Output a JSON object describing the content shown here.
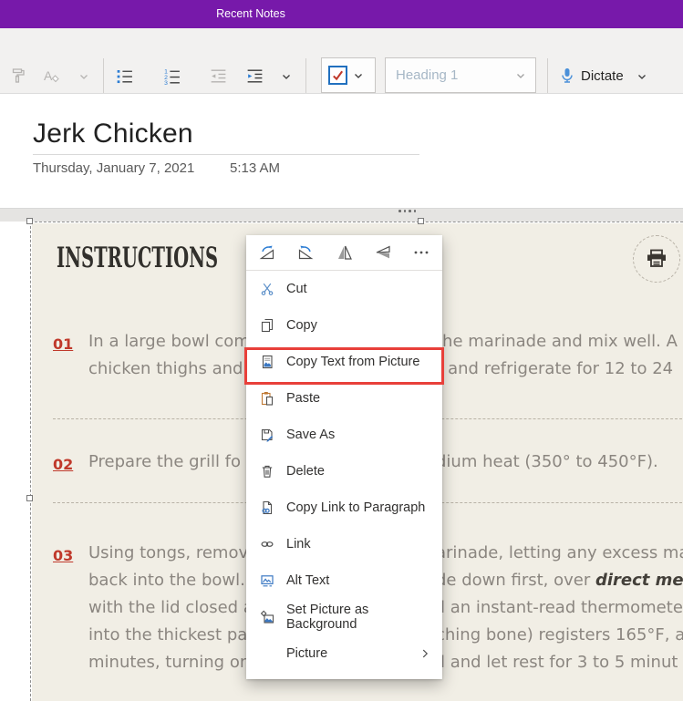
{
  "titlebar": {
    "title": "Recent Notes",
    "bg_color": "#7719AA"
  },
  "toolbar": {
    "style_selector_value": "Heading 1",
    "dictate_label": "Dictate",
    "icons": {
      "format-painter": "brush",
      "clear-formatting": "A-eraser",
      "bullet-list": "dotted-list",
      "numbered-list": "123-list",
      "decrease-indent": "left-arrow-lines",
      "increase-indent": "right-arrow-lines",
      "todo-checkbox": "red-check-in-blue-box",
      "dictate": "blue-microphone"
    }
  },
  "page": {
    "title": "Jerk Chicken",
    "date": "Thursday, January 7, 2021",
    "time": "5:13 AM"
  },
  "recipe": {
    "heading": "INSTRUCTIONS",
    "print_icon": "printer-in-dashed-circle",
    "background_color": "#f1eee5",
    "step_number_color": "#c0392b",
    "steps": {
      "s1": {
        "num": "01",
        "l1": "In a large bowl com",
        "l2": "chicken thighs and",
        "r1": "the marinade and mix well. A",
        "r2": "r and refrigerate for 12 to 24"
      },
      "s2": {
        "num": "02",
        "l1": "Prepare the grill fo",
        "r1": "dium heat (350° to 450°F)."
      },
      "s3": {
        "num": "03",
        "l1": "Using tongs, remov",
        "l2": "back into the bowl.",
        "l3": "with the lid closed a",
        "l4": "into the thickest pa",
        "l5": "minutes, turning on",
        "r1": "arinade, letting any excess ma",
        "r2a": "de down first, over ",
        "r2b": "direct med",
        "r3": "il an instant-read thermomete",
        "r4": "ching bone) registers 165°F, a",
        "r5": "ll and let rest for 3 to 5 minut"
      }
    }
  },
  "context_menu": {
    "quick_icons": [
      "rotate-right",
      "rotate-left",
      "flip-horizontal",
      "flip-vertical",
      "more-options"
    ],
    "items": [
      "Cut",
      "Copy",
      "Copy Text from Picture",
      "Paste",
      "Save As",
      "Delete",
      "Copy Link to Paragraph",
      "Link",
      "Alt Text",
      "Set Picture as Background",
      "Picture"
    ],
    "highlighted_item": "Copy Text from Picture",
    "highlight_color": "#e8403a",
    "accent_blue": "#3b78c3"
  }
}
